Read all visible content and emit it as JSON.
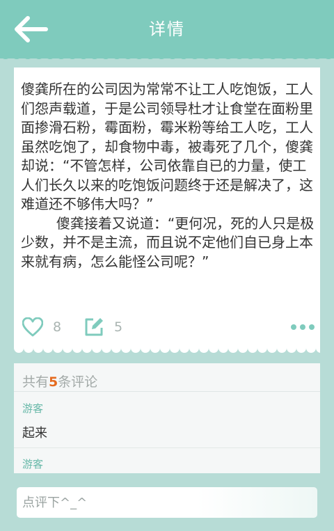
{
  "header": {
    "title": "详情",
    "back_icon": "back-arrow-icon"
  },
  "post": {
    "text": "傻龚所在的公司因为常常不让工人吃饱饭，工人们怨声载道，于是公司领导杜才让食堂在面粉里面掺滑石粉，霉面粉，霉米粉等给工人吃，工人虽然吃饱了，却食物中毒，被毒死了几个，傻龚却说：“不管怎样，公司依靠自已的力量，使工人们长久以来的吃饱饭问题终于还是解决了，这难道还不够伟大吗？”\n        傻龚接着又说道：“更何况，死的人只是极少数，并不是主流，而且说不定他们自已身上本来就有病，怎么能怪公司呢？”",
    "like_count": "8",
    "comment_count": "5",
    "icons": {
      "like": "heart-icon",
      "comment": "edit-icon",
      "more": "more-dots-icon"
    }
  },
  "comments": {
    "header_prefix": "共有",
    "count": "5",
    "header_suffix": "条评论",
    "items": [
      {
        "user": "游客",
        "text": "起来"
      },
      {
        "user": "游客",
        "text": ""
      }
    ]
  },
  "footer": {
    "input_placeholder": "点评下^_^"
  },
  "colors": {
    "header": "#7fcbbd",
    "background": "#b7dcd6",
    "accent": "#7fcbbd",
    "count_highlight": "#e56b1f"
  }
}
